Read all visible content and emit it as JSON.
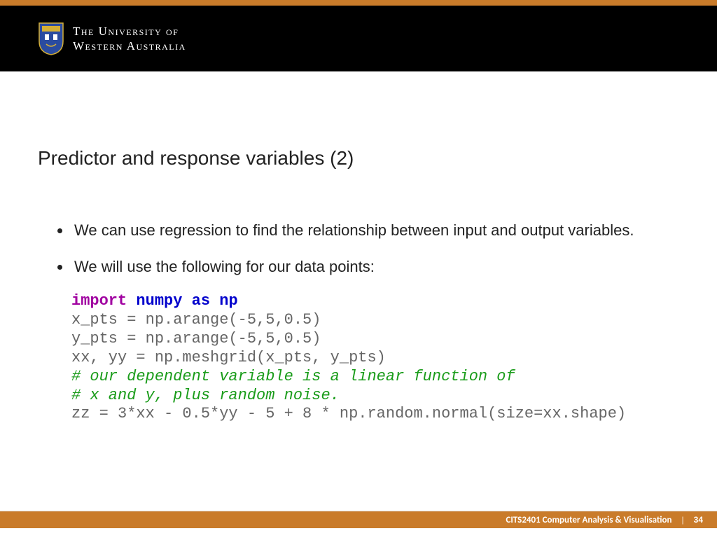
{
  "header": {
    "university_line1": "The University of",
    "university_line2": "Western Australia"
  },
  "slide": {
    "title": "Predictor and response variables (2)",
    "bullets": [
      "We can use regression to find the relationship between input and output variables.",
      "We will use the following for our data points:"
    ]
  },
  "code": {
    "l1_import": "import",
    "l1_numpy": "numpy",
    "l1_as": "as",
    "l1_np": "np",
    "l2": "x_pts = np.arange(-5,5,0.5)",
    "l3": "y_pts = np.arange(-5,5,0.5)",
    "l4": "xx, yy = np.meshgrid(x_pts, y_pts)",
    "l5": "# our dependent variable is a linear function of",
    "l6": "# x and y, plus random noise.",
    "l7": "zz = 3*xx - 0.5*yy - 5 + 8 * np.random.normal(size=xx.shape)"
  },
  "footer": {
    "course": "CITS2401 Computer Analysis & Visualisation",
    "separator": "|",
    "page": "34"
  }
}
